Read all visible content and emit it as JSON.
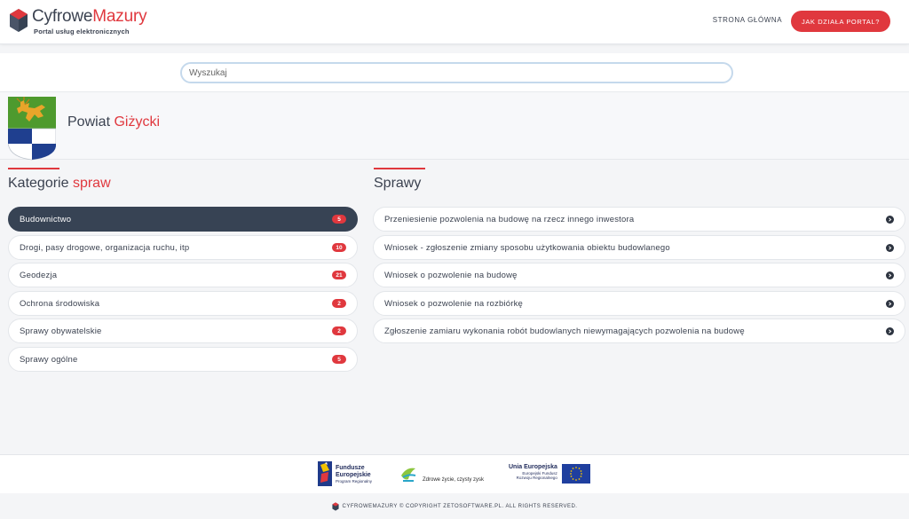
{
  "header": {
    "brand_part1": "Cyfrowe",
    "brand_part2": "Mazury",
    "tagline": "Portal usług elektronicznych",
    "nav_home": "STRONA GŁÓWNA",
    "nav_how": "JAK DZIAŁA PORTAL?"
  },
  "search": {
    "placeholder": "Wyszukaj",
    "value": ""
  },
  "county": {
    "prefix": "Powiat",
    "name": "Giżycki"
  },
  "categories": {
    "title_part1": "Kategorie",
    "title_part2": "spraw",
    "items": [
      {
        "label": "Budownictwo",
        "count": "5",
        "active": true
      },
      {
        "label": "Drogi, pasy drogowe, organizacja ruchu, itp",
        "count": "10",
        "active": false
      },
      {
        "label": "Geodezja",
        "count": "21",
        "active": false
      },
      {
        "label": "Ochrona środowiska",
        "count": "2",
        "active": false
      },
      {
        "label": "Sprawy obywatelskie",
        "count": "2",
        "active": false
      },
      {
        "label": "Sprawy ogólne",
        "count": "5",
        "active": false
      }
    ]
  },
  "cases": {
    "title": "Sprawy",
    "items": [
      {
        "label": "Przeniesienie pozwolenia na budowę na rzecz innego inwestora"
      },
      {
        "label": "Wniosek - zgłoszenie zmiany sposobu użytkowania obiektu budowlanego"
      },
      {
        "label": "Wniosek o pozwolenie na budowę"
      },
      {
        "label": "Wniosek o pozwolenie na rozbiórkę"
      },
      {
        "label": "Zgłoszenie zamiaru wykonania robót budowlanych niewymagających pozwolenia na budowę"
      }
    ]
  },
  "footer": {
    "fe_title_1": "Fundusze",
    "fe_title_2": "Europejskie",
    "fe_sub": "Program Regionalny",
    "wm_slogan": "Zdrowe życie, czysty zysk",
    "ue_title": "Unia Europejska",
    "ue_sub_1": "Europejski Fundusz",
    "ue_sub_2": "Rozwoju Regionalnego",
    "copyright": "CYFROWEMAZURY © COPYRIGHT ZETOSOFTWARE.PL. ALL RIGHTS RESERVED."
  },
  "colors": {
    "accent": "#e0383e",
    "dark": "#374354",
    "text": "#3b4250"
  },
  "icons": {
    "brand": "cube-logo-icon",
    "crest": "county-crest-icon",
    "arrow": "circle-chevron-right-icon"
  }
}
